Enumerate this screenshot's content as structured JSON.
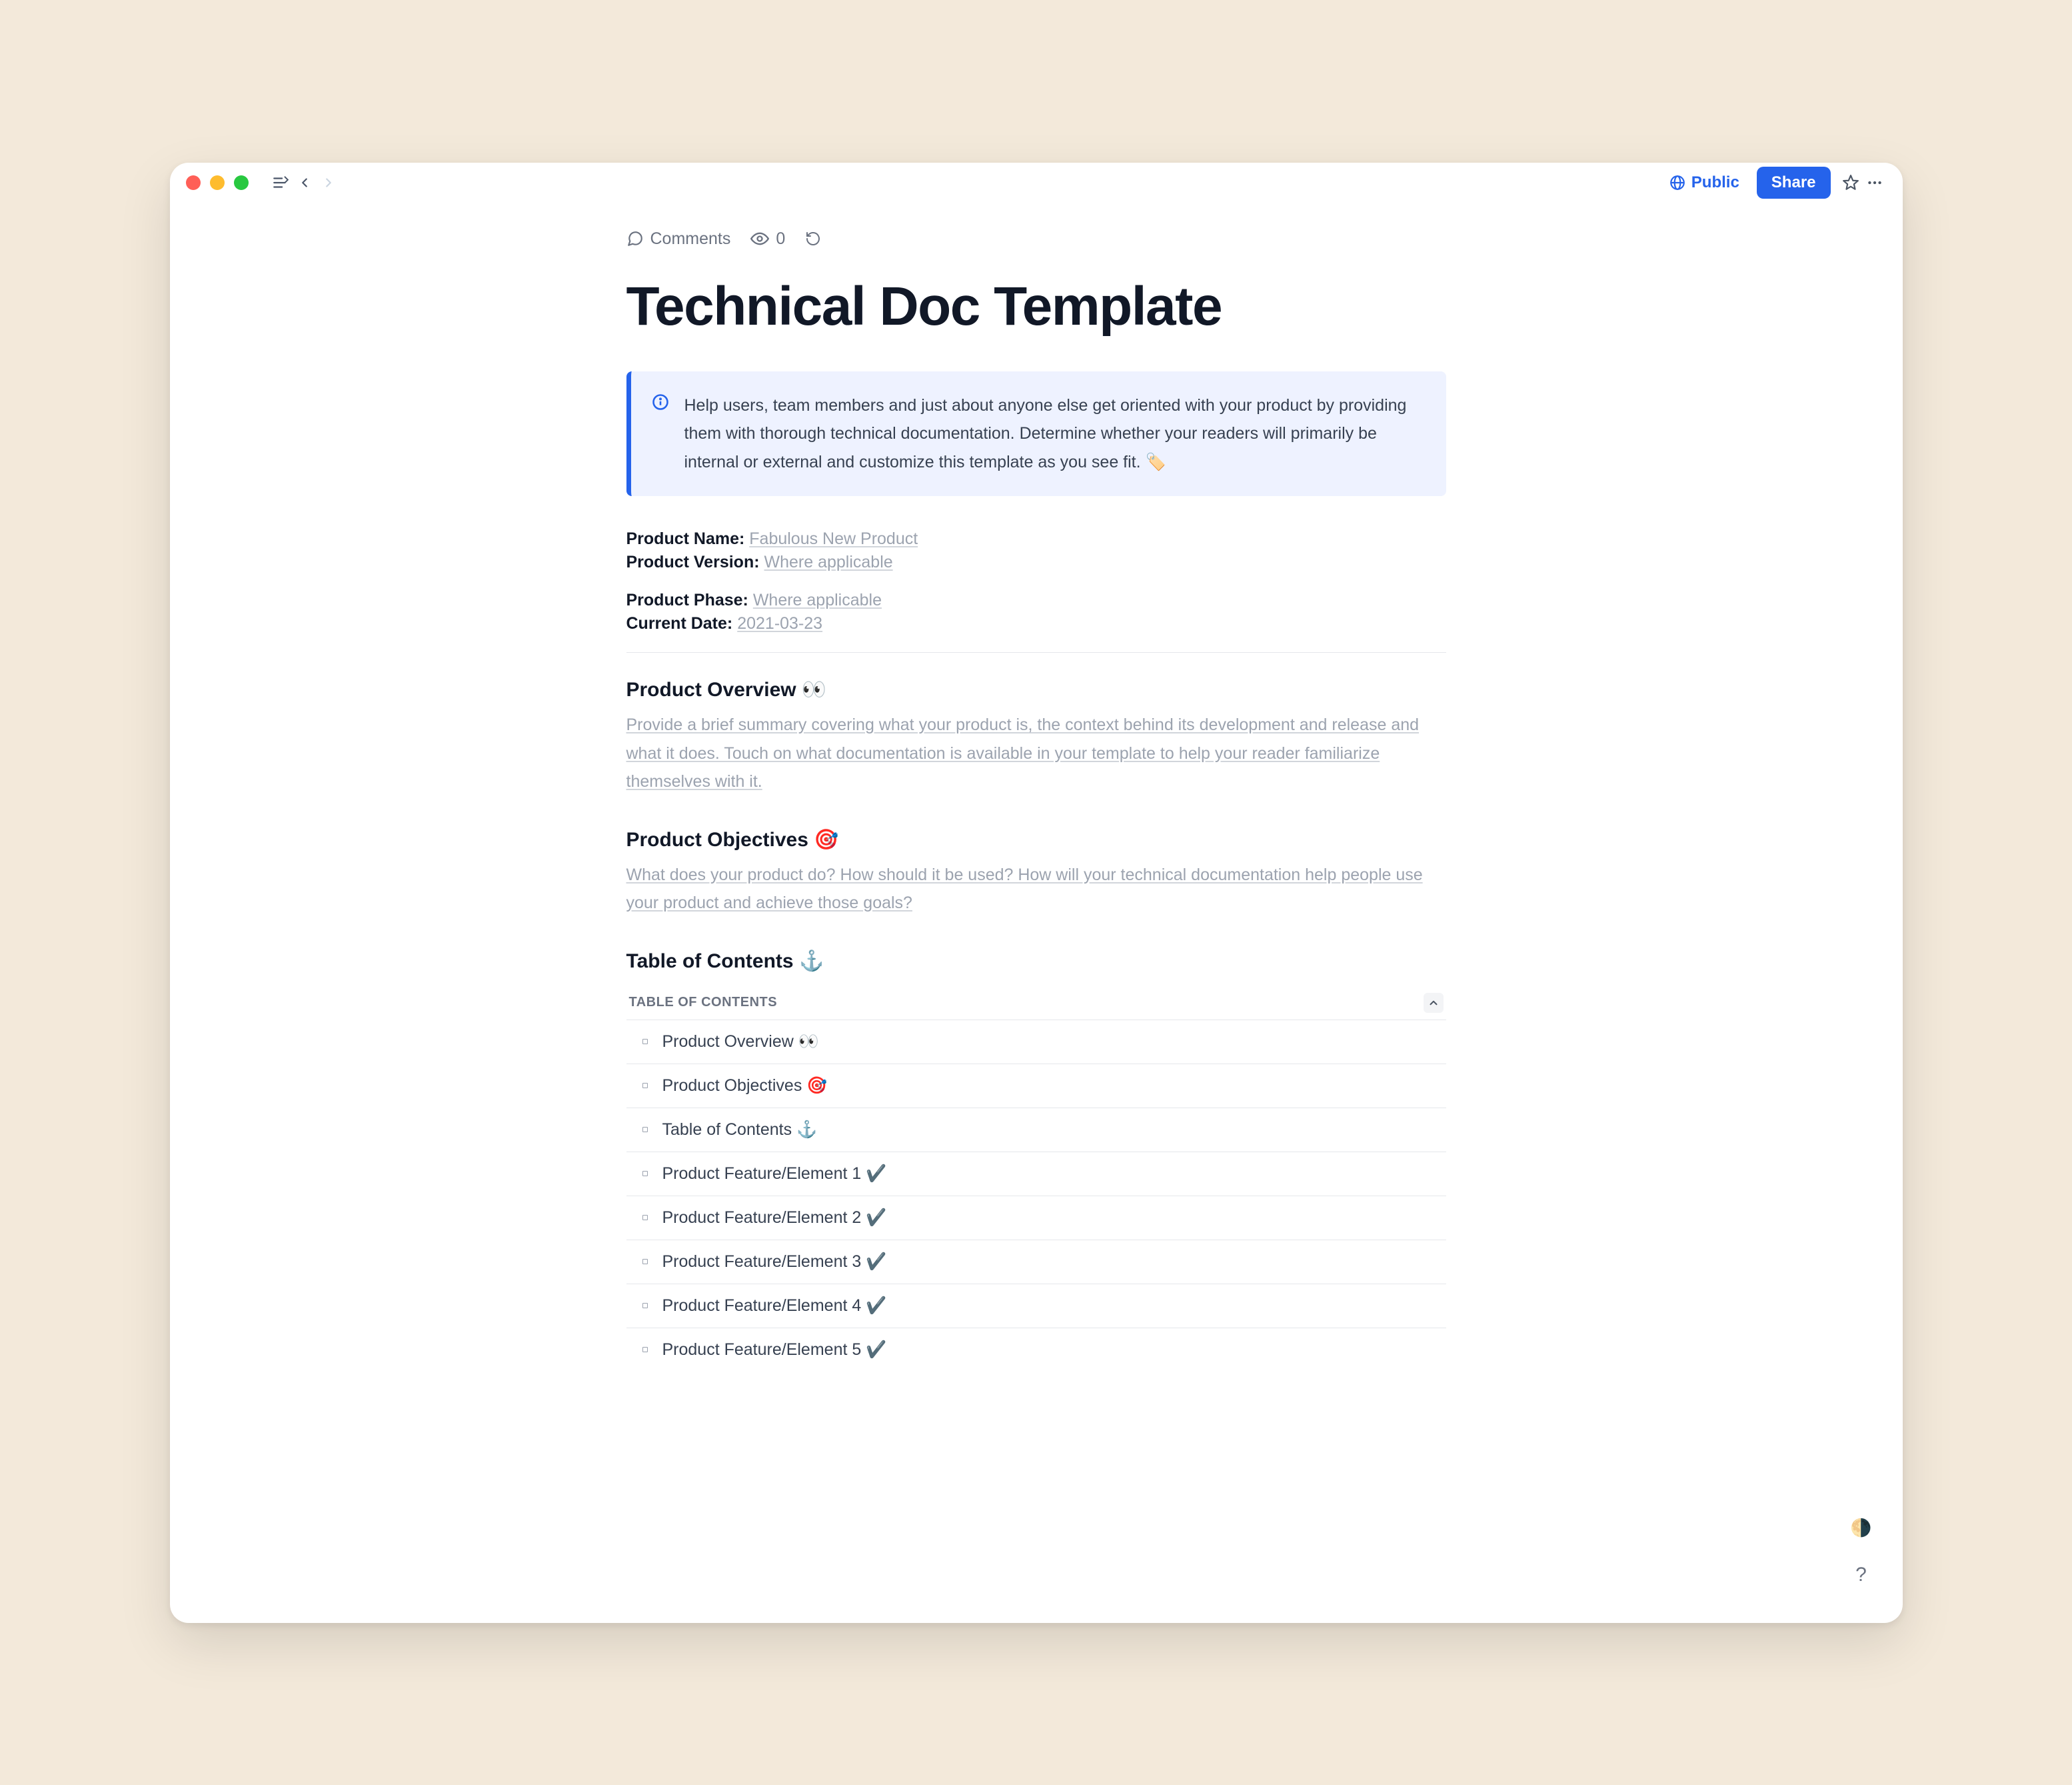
{
  "header": {
    "public_label": "Public",
    "share_label": "Share"
  },
  "meta": {
    "comments_label": "Comments",
    "views_count": "0"
  },
  "title": "Technical Doc Template",
  "callout": {
    "text": "Help users, team members and just about anyone else get oriented with your product by providing them with thorough technical documentation. Determine whether your readers will primarily be internal or external and customize this template as you see fit. 🏷️"
  },
  "fields": {
    "product_name_label": "Product Name:",
    "product_name_value": "Fabulous New Product",
    "product_version_label": "Product Version:",
    "product_version_value": "Where applicable",
    "product_phase_label": "Product Phase:",
    "product_phase_value": "Where applicable",
    "current_date_label": "Current Date:",
    "current_date_value": "2021-03-23"
  },
  "sections": {
    "overview_title": "Product Overview 👀",
    "overview_placeholder": "Provide a brief summary covering what your product is, the context behind its development and release and what it does. Touch on what documentation is available in your template to help your reader familiarize themselves with it.",
    "objectives_title": "Product Objectives 🎯",
    "objectives_placeholder": "What does your product do? How should it be used? How will your technical documentation help people use your product and achieve those goals?",
    "toc_title": "Table of Contents ⚓"
  },
  "toc": {
    "header_label": "TABLE OF CONTENTS",
    "items": [
      "Product Overview 👀",
      "Product Objectives 🎯",
      "Table of Contents ⚓",
      "Product Feature/Element 1 ✔️",
      "Product Feature/Element 2 ✔️",
      "Product Feature/Element 3 ✔️",
      "Product Feature/Element 4 ✔️",
      "Product Feature/Element 5 ✔️"
    ]
  },
  "float": {
    "moon": "🌗",
    "help": "?"
  }
}
